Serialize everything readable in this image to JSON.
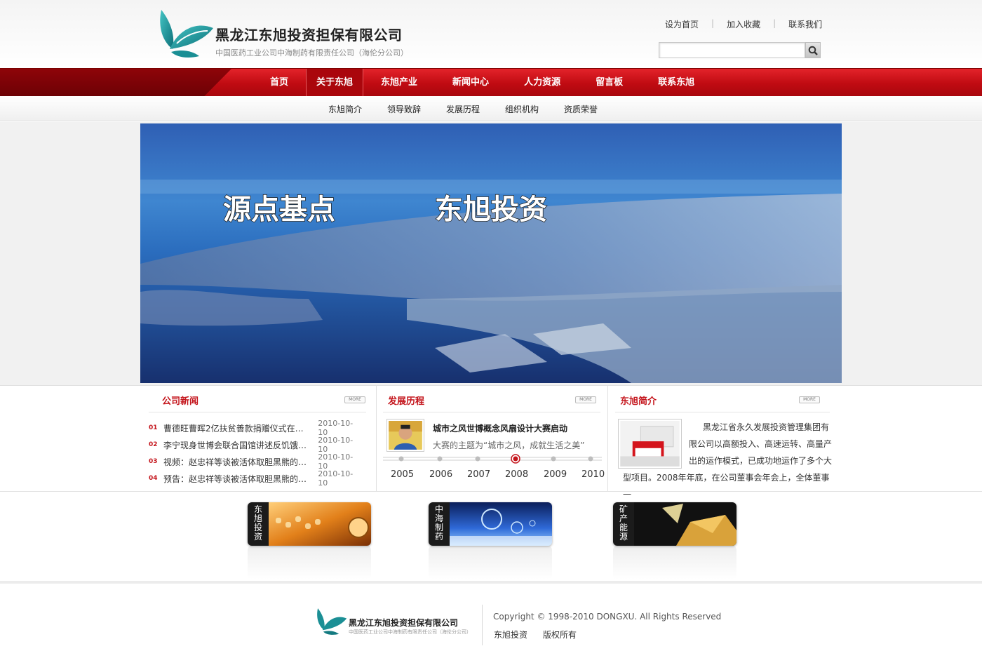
{
  "header": {
    "company_name": "黑龙江东旭投资担保有限公司",
    "company_sub": "中国医药工业公司中海制药有限责任公司（海伦分公司）",
    "top_links": [
      "设为首页",
      "加入收藏",
      "联系我们"
    ],
    "search_placeholder": ""
  },
  "main_nav": [
    "首页",
    "关于东旭",
    "东旭产业",
    "新闻中心",
    "人力资源",
    "留言板",
    "联系东旭"
  ],
  "sub_nav": [
    "东旭简介",
    "领导致辞",
    "发展历程",
    "组织机构",
    "资质荣誉"
  ],
  "banner": {
    "slogan_1": "源点基点",
    "slogan_2": "东旭投资"
  },
  "news": {
    "title": "公司新闻",
    "more": "MORE",
    "items": [
      {
        "num": "01",
        "title": "曹德旺曹晖2亿扶贫善款捐赠仪式在…",
        "date": "2010-10-10"
      },
      {
        "num": "02",
        "title": "李宁现身世博会联合国馆讲述反饥饿…",
        "date": "2010-10-10"
      },
      {
        "num": "03",
        "title": "视频：赵忠祥等谈被活体取胆黑熊的…",
        "date": "2010-10-10"
      },
      {
        "num": "04",
        "title": "预告：赵忠祥等谈被活体取胆黑熊的…",
        "date": "2010-10-10"
      }
    ]
  },
  "history": {
    "title": "发展历程",
    "more": "MORE",
    "headline": "城市之风世博概念风扇设计大赛启动",
    "desc": "大赛的主题为“城市之风，成就生活之美”",
    "years": [
      "2005",
      "2006",
      "2007",
      "2008",
      "2009",
      "2010"
    ],
    "active_year": "2008"
  },
  "intro": {
    "title": "东旭简介",
    "more": "MORE",
    "text": "黑龙江省永久发展投资管理集团有限公司以高额投入、高速运转、高量产出的运作模式，已成功地运作了多个大型项目。2008年年底，在公司董事会年会上，全体董事一"
  },
  "products": [
    {
      "label": "东旭投资"
    },
    {
      "label": "中海制药"
    },
    {
      "label": "矿产能源"
    }
  ],
  "footer": {
    "company_name": "黑龙江东旭投资担保有限公司",
    "company_sub": "中国医药工业公司中海制药有限责任公司（海伦分公司）",
    "copyright": "Copyright © 1998-2010 DONGXU. All Rights Reserved",
    "links": [
      "东旭投资",
      "版权所有"
    ]
  },
  "colors": {
    "brand_red": "#c4151c",
    "logo_teal": "#1b8f95"
  }
}
